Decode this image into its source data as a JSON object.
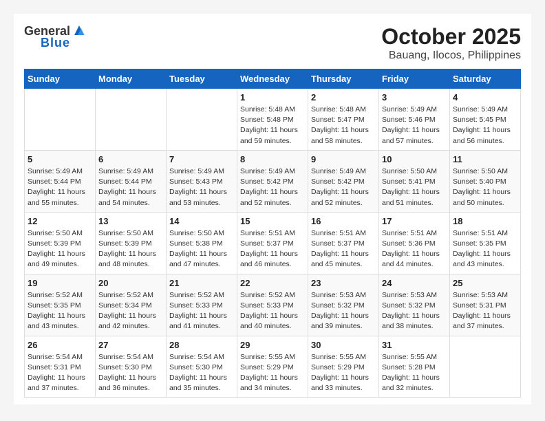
{
  "header": {
    "logo_general": "General",
    "logo_blue": "Blue",
    "month": "October 2025",
    "location": "Bauang, Ilocos, Philippines"
  },
  "weekdays": [
    "Sunday",
    "Monday",
    "Tuesday",
    "Wednesday",
    "Thursday",
    "Friday",
    "Saturday"
  ],
  "weeks": [
    [
      {
        "day": "",
        "info": ""
      },
      {
        "day": "",
        "info": ""
      },
      {
        "day": "",
        "info": ""
      },
      {
        "day": "1",
        "info": "Sunrise: 5:48 AM\nSunset: 5:48 PM\nDaylight: 11 hours\nand 59 minutes."
      },
      {
        "day": "2",
        "info": "Sunrise: 5:48 AM\nSunset: 5:47 PM\nDaylight: 11 hours\nand 58 minutes."
      },
      {
        "day": "3",
        "info": "Sunrise: 5:49 AM\nSunset: 5:46 PM\nDaylight: 11 hours\nand 57 minutes."
      },
      {
        "day": "4",
        "info": "Sunrise: 5:49 AM\nSunset: 5:45 PM\nDaylight: 11 hours\nand 56 minutes."
      }
    ],
    [
      {
        "day": "5",
        "info": "Sunrise: 5:49 AM\nSunset: 5:44 PM\nDaylight: 11 hours\nand 55 minutes."
      },
      {
        "day": "6",
        "info": "Sunrise: 5:49 AM\nSunset: 5:44 PM\nDaylight: 11 hours\nand 54 minutes."
      },
      {
        "day": "7",
        "info": "Sunrise: 5:49 AM\nSunset: 5:43 PM\nDaylight: 11 hours\nand 53 minutes."
      },
      {
        "day": "8",
        "info": "Sunrise: 5:49 AM\nSunset: 5:42 PM\nDaylight: 11 hours\nand 52 minutes."
      },
      {
        "day": "9",
        "info": "Sunrise: 5:49 AM\nSunset: 5:42 PM\nDaylight: 11 hours\nand 52 minutes."
      },
      {
        "day": "10",
        "info": "Sunrise: 5:50 AM\nSunset: 5:41 PM\nDaylight: 11 hours\nand 51 minutes."
      },
      {
        "day": "11",
        "info": "Sunrise: 5:50 AM\nSunset: 5:40 PM\nDaylight: 11 hours\nand 50 minutes."
      }
    ],
    [
      {
        "day": "12",
        "info": "Sunrise: 5:50 AM\nSunset: 5:39 PM\nDaylight: 11 hours\nand 49 minutes."
      },
      {
        "day": "13",
        "info": "Sunrise: 5:50 AM\nSunset: 5:39 PM\nDaylight: 11 hours\nand 48 minutes."
      },
      {
        "day": "14",
        "info": "Sunrise: 5:50 AM\nSunset: 5:38 PM\nDaylight: 11 hours\nand 47 minutes."
      },
      {
        "day": "15",
        "info": "Sunrise: 5:51 AM\nSunset: 5:37 PM\nDaylight: 11 hours\nand 46 minutes."
      },
      {
        "day": "16",
        "info": "Sunrise: 5:51 AM\nSunset: 5:37 PM\nDaylight: 11 hours\nand 45 minutes."
      },
      {
        "day": "17",
        "info": "Sunrise: 5:51 AM\nSunset: 5:36 PM\nDaylight: 11 hours\nand 44 minutes."
      },
      {
        "day": "18",
        "info": "Sunrise: 5:51 AM\nSunset: 5:35 PM\nDaylight: 11 hours\nand 43 minutes."
      }
    ],
    [
      {
        "day": "19",
        "info": "Sunrise: 5:52 AM\nSunset: 5:35 PM\nDaylight: 11 hours\nand 43 minutes."
      },
      {
        "day": "20",
        "info": "Sunrise: 5:52 AM\nSunset: 5:34 PM\nDaylight: 11 hours\nand 42 minutes."
      },
      {
        "day": "21",
        "info": "Sunrise: 5:52 AM\nSunset: 5:33 PM\nDaylight: 11 hours\nand 41 minutes."
      },
      {
        "day": "22",
        "info": "Sunrise: 5:52 AM\nSunset: 5:33 PM\nDaylight: 11 hours\nand 40 minutes."
      },
      {
        "day": "23",
        "info": "Sunrise: 5:53 AM\nSunset: 5:32 PM\nDaylight: 11 hours\nand 39 minutes."
      },
      {
        "day": "24",
        "info": "Sunrise: 5:53 AM\nSunset: 5:32 PM\nDaylight: 11 hours\nand 38 minutes."
      },
      {
        "day": "25",
        "info": "Sunrise: 5:53 AM\nSunset: 5:31 PM\nDaylight: 11 hours\nand 37 minutes."
      }
    ],
    [
      {
        "day": "26",
        "info": "Sunrise: 5:54 AM\nSunset: 5:31 PM\nDaylight: 11 hours\nand 37 minutes."
      },
      {
        "day": "27",
        "info": "Sunrise: 5:54 AM\nSunset: 5:30 PM\nDaylight: 11 hours\nand 36 minutes."
      },
      {
        "day": "28",
        "info": "Sunrise: 5:54 AM\nSunset: 5:30 PM\nDaylight: 11 hours\nand 35 minutes."
      },
      {
        "day": "29",
        "info": "Sunrise: 5:55 AM\nSunset: 5:29 PM\nDaylight: 11 hours\nand 34 minutes."
      },
      {
        "day": "30",
        "info": "Sunrise: 5:55 AM\nSunset: 5:29 PM\nDaylight: 11 hours\nand 33 minutes."
      },
      {
        "day": "31",
        "info": "Sunrise: 5:55 AM\nSunset: 5:28 PM\nDaylight: 11 hours\nand 32 minutes."
      },
      {
        "day": "",
        "info": ""
      }
    ]
  ]
}
